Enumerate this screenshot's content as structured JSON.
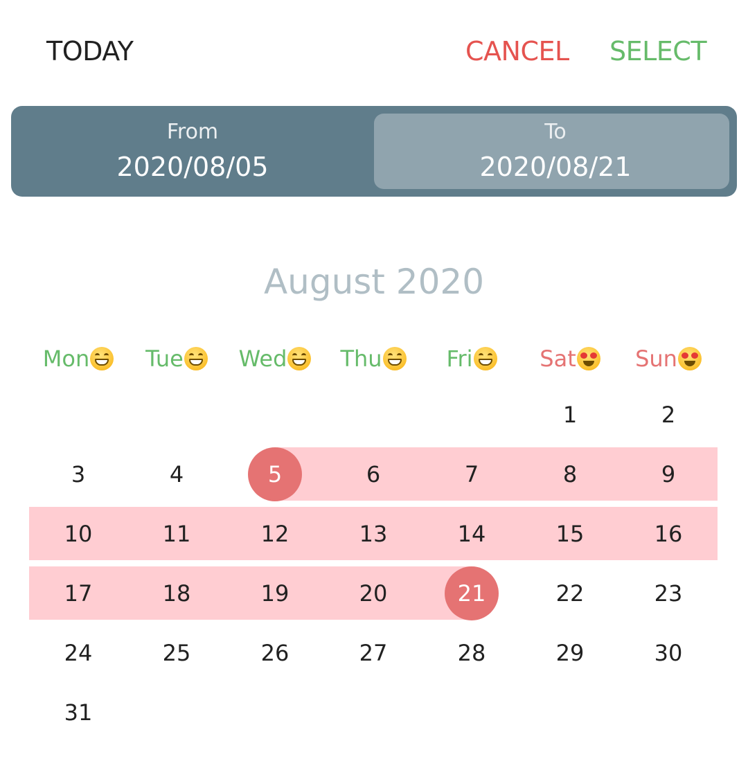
{
  "toolbar": {
    "today_label": "TODAY",
    "cancel_label": "CANCEL",
    "select_label": "SELECT",
    "cancel_color": "#e5534f",
    "select_color": "#66bb6a"
  },
  "range": {
    "from_label": "From",
    "from_value": "2020/08/05",
    "to_label": "To",
    "to_value": "2020/08/21",
    "bar_color": "#607d8b",
    "active_color": "#90a4ae"
  },
  "calendar": {
    "month_title": "August 2020",
    "weekdays": [
      {
        "label": "Mon",
        "emoji": "grinning-face-icon",
        "color": "#66bb6a"
      },
      {
        "label": "Tue",
        "emoji": "grinning-face-icon",
        "color": "#66bb6a"
      },
      {
        "label": "Wed",
        "emoji": "grinning-face-icon",
        "color": "#66bb6a"
      },
      {
        "label": "Thu",
        "emoji": "grinning-face-icon",
        "color": "#66bb6a"
      },
      {
        "label": "Fri",
        "emoji": "grinning-face-icon",
        "color": "#66bb6a"
      },
      {
        "label": "Sat",
        "emoji": "heart-eyes-face-icon",
        "color": "#e57373"
      },
      {
        "label": "Sun",
        "emoji": "heart-eyes-face-icon",
        "color": "#e57373"
      }
    ],
    "first_weekday_index": 5,
    "days_in_month": 31,
    "day_labels": [
      "1",
      "2",
      "3",
      "4",
      "5",
      "6",
      "7",
      "8",
      "9",
      "10",
      "11",
      "12",
      "13",
      "14",
      "15",
      "16",
      "17",
      "18",
      "19",
      "20",
      "21",
      "22",
      "23",
      "24",
      "25",
      "26",
      "27",
      "28",
      "29",
      "30",
      "31"
    ],
    "range_start": 5,
    "range_end": 21,
    "range_band_color": "#ffcdd2",
    "endpoint_color": "#e57373"
  }
}
